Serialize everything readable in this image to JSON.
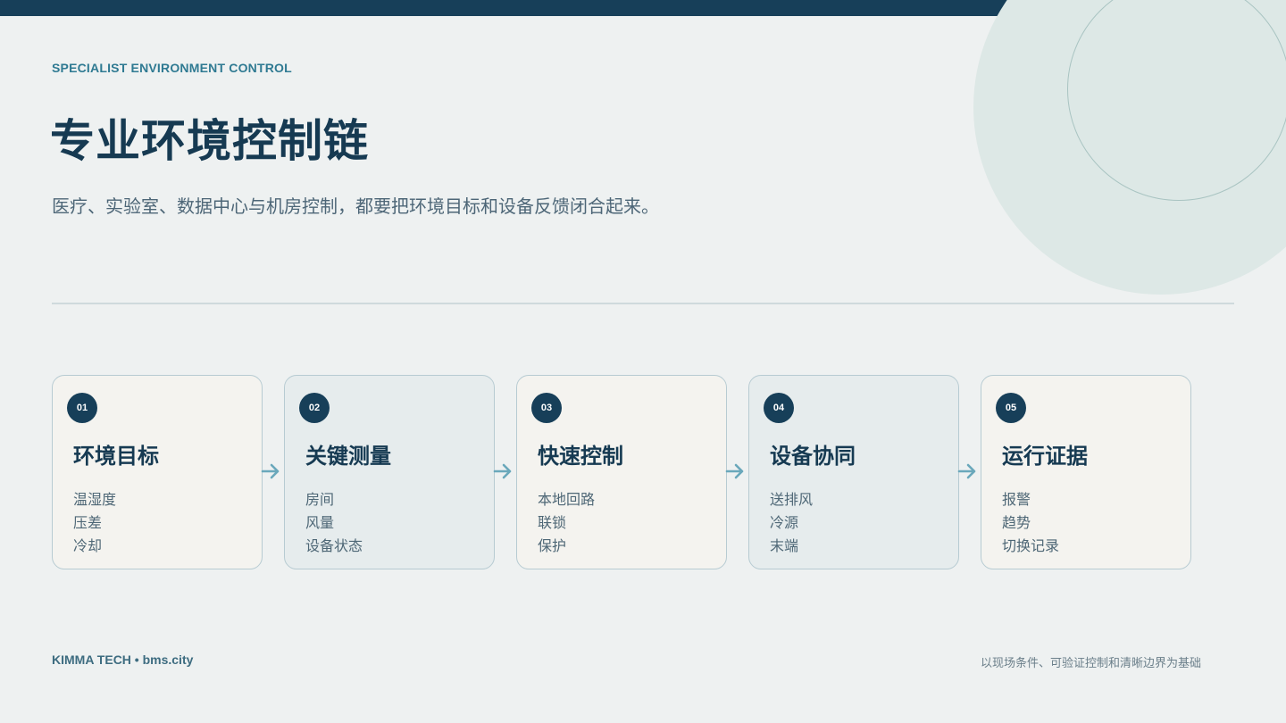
{
  "header": {
    "eyebrow": "SPECIALIST ENVIRONMENT CONTROL",
    "title": "专业环境控制链",
    "subtitle": "医疗、实验室、数据中心与机房控制，都要把环境目标和设备反馈闭合起来。"
  },
  "steps": [
    {
      "number": "01",
      "title": "环境目标",
      "items": [
        "温湿度",
        "压差",
        "冷却"
      ]
    },
    {
      "number": "02",
      "title": "关键测量",
      "items": [
        "房间",
        "风量",
        "设备状态"
      ]
    },
    {
      "number": "03",
      "title": "快速控制",
      "items": [
        "本地回路",
        "联锁",
        "保护"
      ]
    },
    {
      "number": "04",
      "title": "设备协同",
      "items": [
        "送排风",
        "冷源",
        "末端"
      ]
    },
    {
      "number": "05",
      "title": "运行证据",
      "items": [
        "报警",
        "趋势",
        "切换记录"
      ]
    }
  ],
  "footer": {
    "brand": "KIMMA TECH • bms.city",
    "tagline": "以现场条件、可验证控制和清晰边界为基础"
  },
  "colors": {
    "navy": "#173f59",
    "accent": "#2f7a92",
    "arrow": "#6aa8bb",
    "background": "#eef1f1"
  },
  "icons": {
    "connector": "arrow-right-icon"
  }
}
